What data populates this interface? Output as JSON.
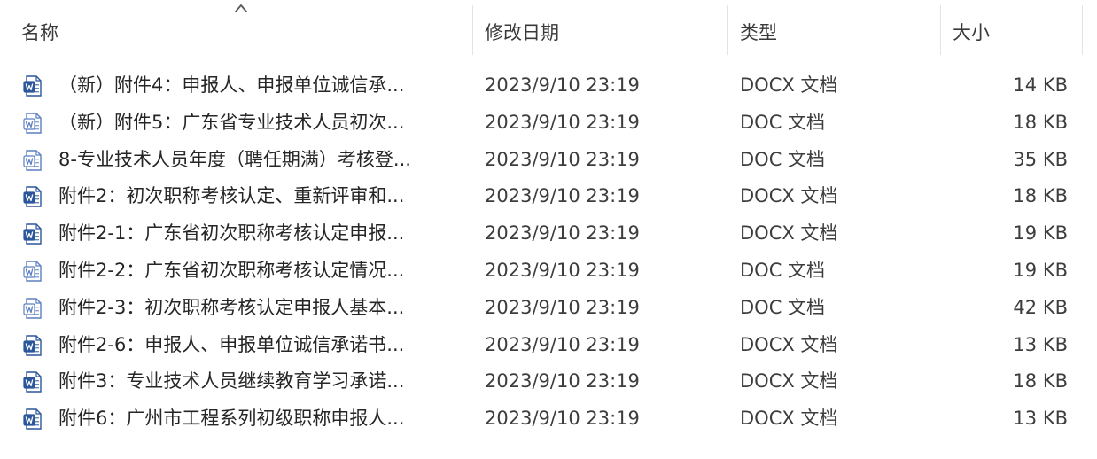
{
  "columns": {
    "name": "名称",
    "modified": "修改日期",
    "type": "类型",
    "size": "大小"
  },
  "sort": {
    "column": "name",
    "direction": "ascending",
    "icon": "chevron-up-icon"
  },
  "icons": {
    "docx": "word-document-icon",
    "doc": "word-legacy-document-icon"
  },
  "colors": {
    "word_blue": "#2b579a",
    "legacy_blue": "#5b7fc0",
    "page": "#ffffff"
  },
  "files": [
    {
      "name": "（新）附件4：申报人、申报单位诚信承...",
      "modified": "2023/9/10 23:19",
      "type": "DOCX 文档",
      "size": "14 KB",
      "format": "docx"
    },
    {
      "name": "（新）附件5：广东省专业技术人员初次...",
      "modified": "2023/9/10 23:19",
      "type": "DOC 文档",
      "size": "18 KB",
      "format": "doc"
    },
    {
      "name": "8-专业技术人员年度（聘任期满）考核登...",
      "modified": "2023/9/10 23:19",
      "type": "DOC 文档",
      "size": "35 KB",
      "format": "doc"
    },
    {
      "name": "附件2：初次职称考核认定、重新评审和...",
      "modified": "2023/9/10 23:19",
      "type": "DOCX 文档",
      "size": "18 KB",
      "format": "docx"
    },
    {
      "name": "附件2-1：广东省初次职称考核认定申报...",
      "modified": "2023/9/10 23:19",
      "type": "DOCX 文档",
      "size": "19 KB",
      "format": "docx"
    },
    {
      "name": "附件2-2：广东省初次职称考核认定情况...",
      "modified": "2023/9/10 23:19",
      "type": "DOC 文档",
      "size": "19 KB",
      "format": "doc"
    },
    {
      "name": "附件2-3：初次职称考核认定申报人基本...",
      "modified": "2023/9/10 23:19",
      "type": "DOC 文档",
      "size": "42 KB",
      "format": "doc"
    },
    {
      "name": "附件2-6：申报人、申报单位诚信承诺书...",
      "modified": "2023/9/10 23:19",
      "type": "DOCX 文档",
      "size": "13 KB",
      "format": "docx"
    },
    {
      "name": "附件3：专业技术人员继续教育学习承诺...",
      "modified": "2023/9/10 23:19",
      "type": "DOCX 文档",
      "size": "18 KB",
      "format": "docx"
    },
    {
      "name": "附件6：广州市工程系列初级职称申报人...",
      "modified": "2023/9/10 23:19",
      "type": "DOCX 文档",
      "size": "13 KB",
      "format": "docx"
    }
  ]
}
